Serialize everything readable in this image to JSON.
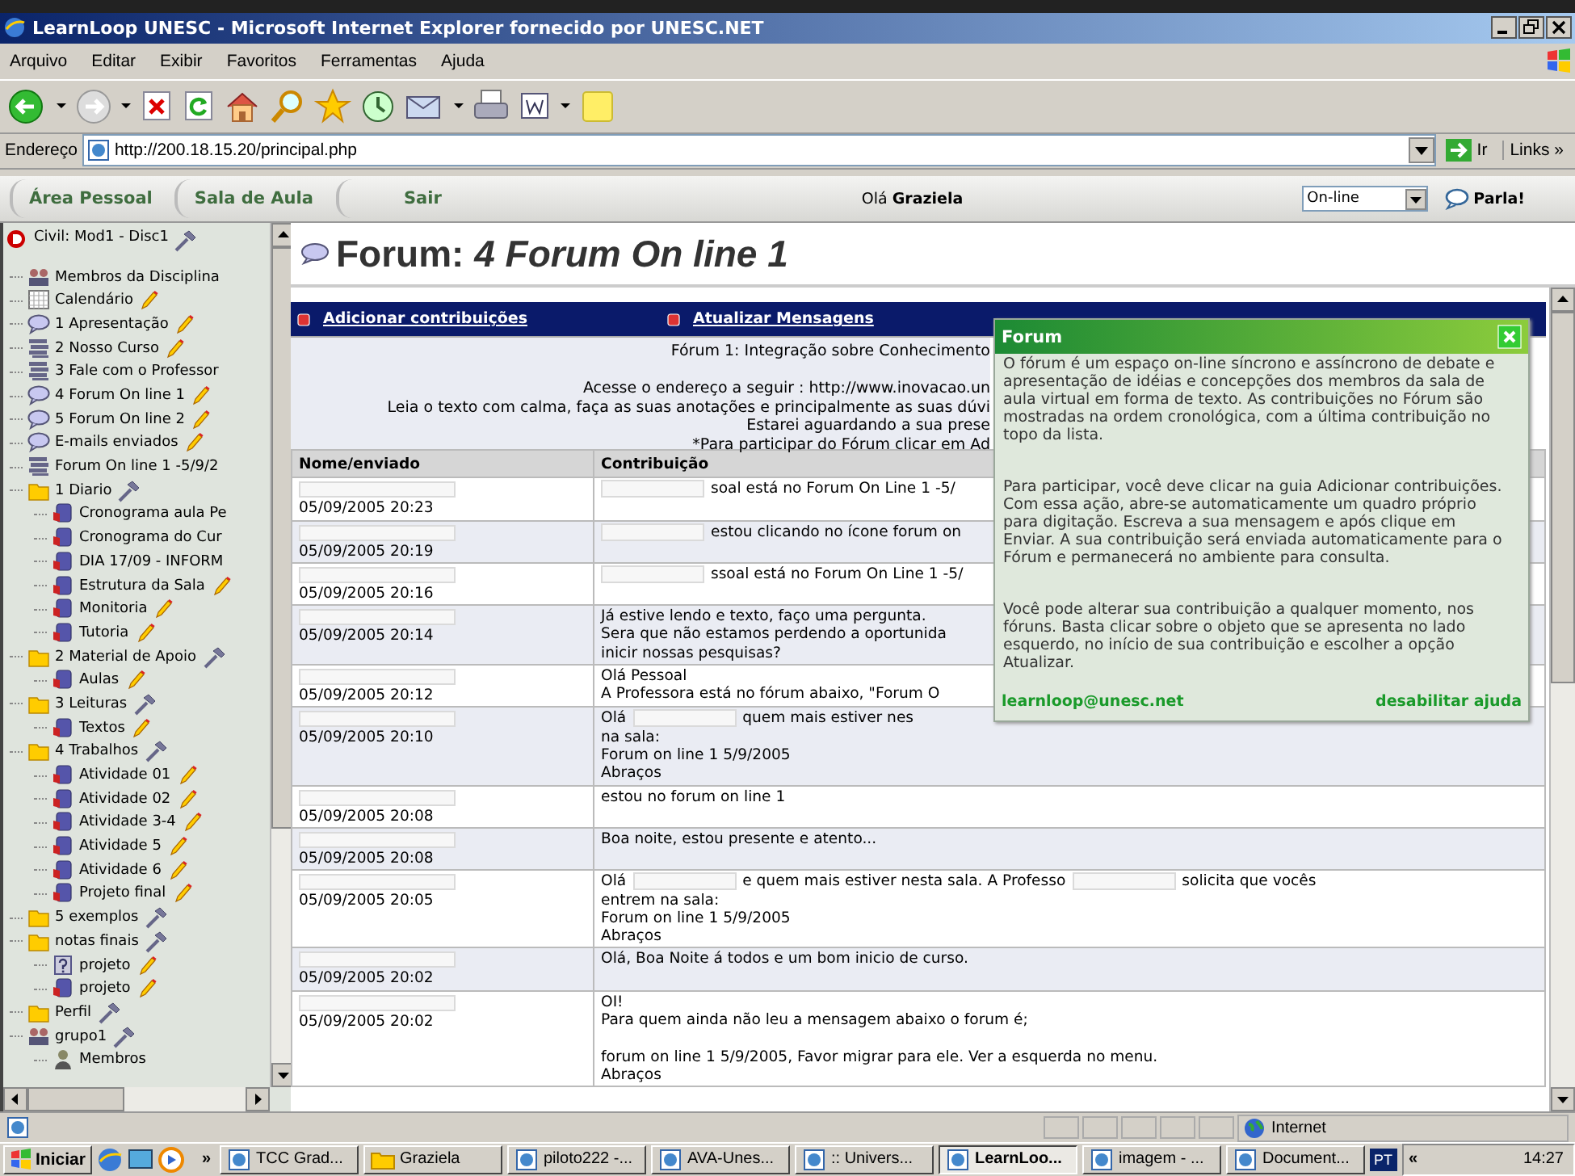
{
  "window": {
    "title": "LearnLoop UNESC - Microsoft Internet Explorer fornecido por UNESC.NET"
  },
  "menu": [
    "Arquivo",
    "Editar",
    "Exibir",
    "Favoritos",
    "Ferramentas",
    "Ajuda"
  ],
  "address_bar": {
    "label": "Endereço",
    "value": "http://200.18.15.20/principal.php",
    "go": "Ir",
    "links": "Links",
    "more": "»"
  },
  "app_nav": {
    "tabs": [
      "Área Pessoal",
      "Sala de Aula",
      "Sair"
    ],
    "greeting": "Olá **Graziela**",
    "status": "On-line",
    "chat": "Parla!"
  },
  "sidebar": {
    "items": [
      {
        "label": "Civil: Mod1 - Disc1",
        "kind": "course",
        "manage": true,
        "children": [
          {
            "label": "Membros da Disciplina",
            "kind": "members"
          },
          {
            "label": "Calendário",
            "kind": "calendar",
            "edit": true
          },
          {
            "label": "1 Apresentação",
            "kind": "chat",
            "edit": true
          },
          {
            "label": "2 Nosso Curso",
            "kind": "list",
            "edit": true
          },
          {
            "label": "3 Fale com o Professor",
            "kind": "list"
          },
          {
            "label": "4 Forum On line 1",
            "kind": "chat",
            "edit": true
          },
          {
            "label": "5 Forum On line 2",
            "kind": "chat",
            "edit": true
          },
          {
            "label": "E-mails enviados",
            "kind": "chat",
            "edit": true
          },
          {
            "label": "Forum On line 1 -5/9/2",
            "kind": "list"
          },
          {
            "label": "1 Diario",
            "kind": "folder",
            "manage": true,
            "children": [
              {
                "label": "Cronograma aula Pe",
                "kind": "doc"
              },
              {
                "label": "Cronograma do Cur",
                "kind": "doc"
              },
              {
                "label": "DIA 17/09 - INFORM",
                "kind": "doc"
              },
              {
                "label": "Estrutura da Sala",
                "kind": "doc",
                "edit": true
              },
              {
                "label": "Monitoria",
                "kind": "doc",
                "edit": true
              },
              {
                "label": "Tutoria",
                "kind": "doc",
                "edit": true
              }
            ]
          },
          {
            "label": "2 Material de Apoio",
            "kind": "folder",
            "manage": true,
            "children": [
              {
                "label": "Aulas",
                "kind": "doc",
                "edit": true
              }
            ]
          },
          {
            "label": "3 Leituras",
            "kind": "folder",
            "manage": true,
            "children": [
              {
                "label": "Textos",
                "kind": "doc",
                "edit": true
              }
            ]
          },
          {
            "label": "4 Trabalhos",
            "kind": "folder",
            "manage": true,
            "children": [
              {
                "label": "Atividade 01",
                "kind": "doc",
                "edit": true
              },
              {
                "label": "Atividade 02",
                "kind": "doc",
                "edit": true
              },
              {
                "label": "Atividade 3-4",
                "kind": "doc",
                "edit": true
              },
              {
                "label": "Atividade 5",
                "kind": "doc",
                "edit": true
              },
              {
                "label": "Atividade 6",
                "kind": "doc",
                "edit": true
              },
              {
                "label": "Projeto final",
                "kind": "doc",
                "edit": true
              }
            ]
          },
          {
            "label": "5 exemplos",
            "kind": "folder",
            "manage": true
          },
          {
            "label": "notas finais",
            "kind": "folder",
            "manage": true,
            "children": [
              {
                "label": "projeto",
                "kind": "question",
                "edit": true
              },
              {
                "label": "projeto",
                "kind": "doc",
                "edit": true
              }
            ]
          },
          {
            "label": "Perfil",
            "kind": "folder",
            "manage": true
          },
          {
            "label": "grupo1",
            "kind": "members",
            "manage": true,
            "children": [
              {
                "label": "Membros",
                "kind": "person"
              }
            ]
          }
        ]
      }
    ]
  },
  "forum": {
    "title": "Forum: *4 Forum On line 1*",
    "actions": [
      "Adicionar contribuições",
      "Atualizar Mensagens"
    ],
    "intro": {
      "heading": "Fórum 1: Integração sobre Conhecimento",
      "lines": [
        "Acesse o endereço a seguir : http://www.inovacao.un",
        "Leia o texto com calma, faça as suas anotações e principalmente as suas dúvi",
        "Estarei aguardando a sua prese",
        "*Para participar do Fórum clicar em Ad"
      ]
    },
    "columns": [
      "Nome/enviado",
      "Contribuição"
    ],
    "rows": [
      {
        "name_redacted": true,
        "date": "05/09/2005 20:23",
        "lines": [
          [
            {
              "kind": "redaction"
            },
            {
              "kind": "text",
              "text": "soal está no Forum On Line 1 -5/"
            }
          ]
        ]
      },
      {
        "name_redacted": true,
        "date": "05/09/2005 20:19",
        "lines": [
          [
            {
              "kind": "redaction"
            },
            {
              "kind": "text",
              "text": "estou clicando no ícone forum on"
            }
          ]
        ]
      },
      {
        "name_redacted": true,
        "date": "05/09/2005 20:16",
        "lines": [
          [
            {
              "kind": "redaction"
            },
            {
              "kind": "text",
              "text": "ssoal está no Forum On Line 1 -5/"
            }
          ]
        ]
      },
      {
        "name_redacted": true,
        "date": "05/09/2005 20:14",
        "lines": [
          [
            {
              "kind": "text",
              "text": "Já estive lendo e texto, faço uma pergunta."
            }
          ],
          [
            {
              "kind": "text",
              "text": "Sera que não estamos perdendo a oportunida"
            }
          ],
          [
            {
              "kind": "text",
              "text": "inicir nossas pesquisas?"
            }
          ]
        ]
      },
      {
        "name_redacted": true,
        "date": "05/09/2005 20:12",
        "lines": [
          [
            {
              "kind": "text",
              "text": "Olá Pessoal"
            }
          ],
          [
            {
              "kind": "text",
              "text": "A Professora está no fórum abaixo, \"Forum O"
            }
          ]
        ]
      },
      {
        "name_redacted": true,
        "date": "05/09/2005 20:10",
        "lines": [
          [
            {
              "kind": "text",
              "text": "Olá"
            },
            {
              "kind": "redaction"
            },
            {
              "kind": "text",
              "text": "quem mais estiver nes"
            }
          ],
          [
            {
              "kind": "text",
              "text": "na sala:"
            }
          ],
          [
            {
              "kind": "text",
              "text": "Forum on line 1 5/9/2005"
            }
          ],
          [
            {
              "kind": "text",
              "text": "Abraços"
            }
          ]
        ]
      },
      {
        "name_redacted": true,
        "date": "05/09/2005 20:08",
        "lines": [
          [
            {
              "kind": "text",
              "text": "estou no forum on line 1"
            }
          ]
        ]
      },
      {
        "name_redacted": true,
        "date": "05/09/2005 20:08",
        "lines": [
          [
            {
              "kind": "text",
              "text": "Boa noite, estou presente e atento..."
            }
          ]
        ]
      },
      {
        "name_redacted": true,
        "date": "05/09/2005 20:05",
        "lines": [
          [
            {
              "kind": "text",
              "text": "Olá"
            },
            {
              "kind": "redaction"
            },
            {
              "kind": "text",
              "text": "e quem mais estiver nesta sala. A Professo"
            },
            {
              "kind": "redaction"
            },
            {
              "kind": "text",
              "text": "solicita que vocês"
            }
          ],
          [
            {
              "kind": "text",
              "text": "entrem na sala:"
            }
          ],
          [
            {
              "kind": "text",
              "text": "Forum on line 1 5/9/2005"
            }
          ],
          [
            {
              "kind": "text",
              "text": "Abraços"
            }
          ]
        ]
      },
      {
        "name_redacted": true,
        "date": "05/09/2005 20:02",
        "lines": [
          [
            {
              "kind": "text",
              "text": "Olá, Boa Noite á todos e um bom inicio de curso."
            }
          ]
        ]
      },
      {
        "name_redacted": true,
        "date": "05/09/2005 20:02",
        "lines": [
          [
            {
              "kind": "text",
              "text": "OI!"
            }
          ],
          [
            {
              "kind": "text",
              "text": "Para quem ainda não leu a mensagem abaixo o forum é;"
            }
          ],
          [
            {
              "kind": "blank"
            }
          ],
          [
            {
              "kind": "text",
              "text": "forum on line 1 5/9/2005, Favor migrar para ele. Ver a esquerda no menu."
            }
          ],
          [
            {
              "kind": "text",
              "text": "Abraços"
            }
          ]
        ]
      }
    ]
  },
  "help_popup": {
    "title": "Forum",
    "paragraphs": [
      "O fórum é um espaço on-line síncrono e assíncrono de debate e apresentação de idéias e concepções dos membros da sala de aula virtual em forma de texto. As contribuições no Fórum são mostradas na ordem cronológica, com a última contribuição no topo da lista.",
      "Para participar, você deve clicar na guia Adicionar contribuições. Com essa ação, abre-se automaticamente um quadro próprio para digitação. Escreva a sua mensagem e após clique em Enviar. A sua contribuição será enviada automaticamente para o Fórum e permanecerá no ambiente para consulta.",
      "Você pode alterar sua contribuição a qualquer momento, nos fóruns. Basta clicar sobre o objeto que se apresenta no lado esquerdo, no início de sua contribuição e escolher a opção Atualizar."
    ],
    "email": "learnloop@unesc.net",
    "disable": "desabilitar ajuda"
  },
  "status_bar": {
    "zone": "Internet"
  },
  "taskbar": {
    "start": "Iniciar",
    "more": "»",
    "tasks": [
      {
        "label": "TCC Grad...",
        "selected": false
      },
      {
        "label": "Graziela",
        "selected": false
      },
      {
        "label": "piloto222 -...",
        "selected": false
      },
      {
        "label": "AVA-Unes...",
        "selected": false
      },
      {
        "label": ":: Univers...",
        "selected": false
      },
      {
        "label": "LearnLoo...",
        "selected": true
      },
      {
        "label": "imagem - ...",
        "selected": false
      },
      {
        "label": "Document...",
        "selected": false
      }
    ],
    "language": "PT",
    "collapse": "«",
    "clock": "14:27"
  }
}
